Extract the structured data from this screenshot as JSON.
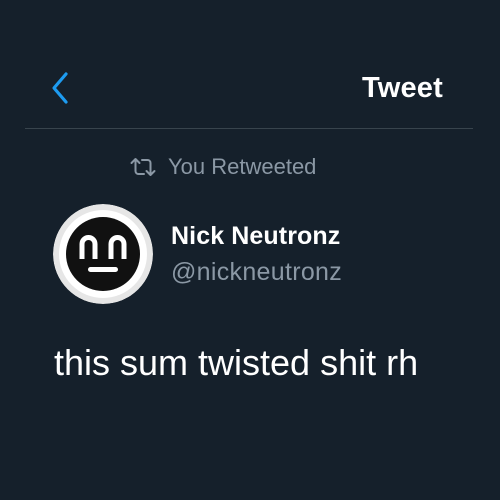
{
  "header": {
    "title": "Tweet",
    "back_icon": "chevron-left-icon"
  },
  "retweet_context": {
    "icon": "retweet-icon",
    "label": "You Retweeted"
  },
  "tweet": {
    "author": {
      "display_name": "Nick Neutronz",
      "handle": "@nickneutronz",
      "avatar_icon": "avatar-face-logo"
    },
    "text": "this sum twisted shit rh"
  },
  "colors": {
    "background": "#15202b",
    "accent": "#1d9bf0",
    "secondary_text": "#8b98a5",
    "divider": "#38444d"
  }
}
